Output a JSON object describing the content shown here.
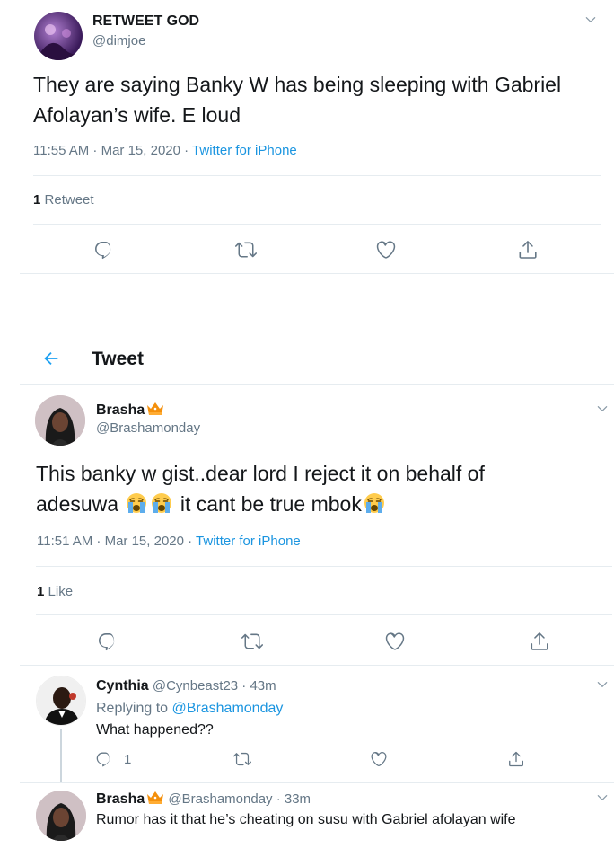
{
  "tweet1": {
    "name": "RETWEET GOD",
    "handle": "@dimjoe",
    "text": "They are saying Banky W has being sleeping with Gabriel Afolayan’s wife. E loud",
    "time": "11:55 AM · Mar 15, 2020 · ",
    "source": "Twitter for iPhone",
    "stat_count": "1",
    "stat_label": "Retweet"
  },
  "header": {
    "title": "Tweet"
  },
  "tweet2": {
    "name": "Brasha",
    "handle": "@Brashamonday",
    "text_line1": "This banky w gist..dear lord I reject it on behalf of",
    "text_line2_a": "adesuwa",
    "text_line2_b": "it cant be true mbok",
    "time": "11:51 AM · Mar 15, 2020 · ",
    "source": "Twitter for iPhone",
    "stat_count": "1",
    "stat_label": "Like"
  },
  "reply1": {
    "name": "Cynthia",
    "handle_time": "@Cynbeast23 · 43m",
    "replying_prefix": "Replying to ",
    "replying_to": "@Brashamonday",
    "text": "What happened??",
    "reply_count": "1"
  },
  "reply2": {
    "name": "Brasha",
    "handle_time": "@Brashamonday · 33m",
    "text": "Rumor has it that he’s cheating on susu with Gabriel afolayan wife"
  },
  "colors": {
    "link": "#1b95e0",
    "muted": "#657786",
    "divider": "#e6ecf0"
  },
  "icons": [
    "chevron-down-icon",
    "reply-icon",
    "retweet-icon",
    "like-icon",
    "share-icon",
    "back-arrow-icon",
    "crying-face-emoji",
    "crown-emoji"
  ]
}
